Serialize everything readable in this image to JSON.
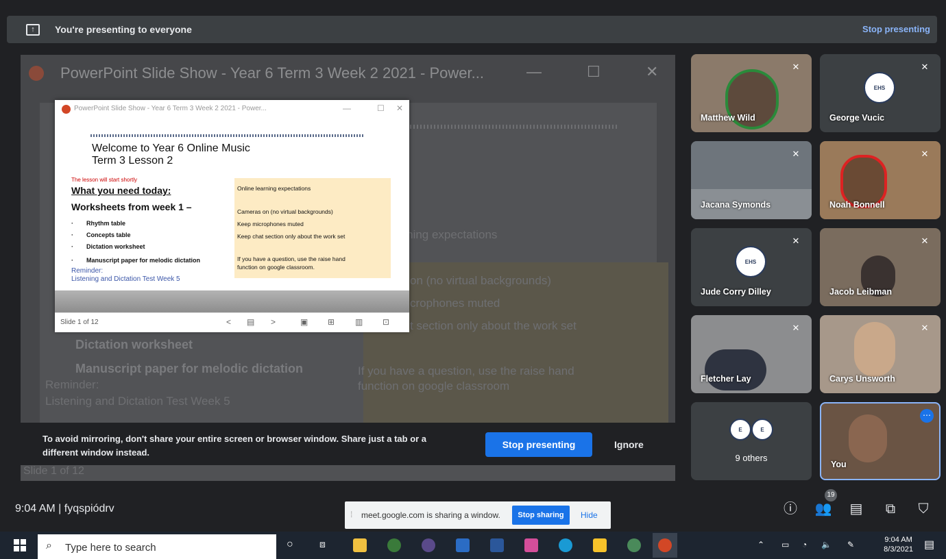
{
  "banner": {
    "text": "You're presenting to everyone",
    "stop_label": "Stop presenting"
  },
  "stage": {
    "bg_title": "PowerPoint Slide Show  -  Year 6 Term 3 Week 2 2021 - Power...",
    "bg_lines": [
      "arning expectations",
      "on (no virtual backgrounds)",
      "crophones muted",
      "t section only about the work set"
    ],
    "bg_items": [
      "Dictation worksheet",
      "Manuscript paper for melodic dictation"
    ],
    "bg_reminder": [
      "Reminder:",
      "Listening and Dictation Test Week 5"
    ],
    "bg_question": [
      "If you have a question, use the raise hand",
      "function on google classroom"
    ],
    "bg_status": "Slide 1 of 12"
  },
  "slide": {
    "window_title": "PowerPoint Slide Show  -  Year 6 Term 3 Week 2 2021 - Power...",
    "title_line1": "Welcome to Year 6 Online Music",
    "title_line2": "Term 3 Lesson 2",
    "red_note": "The lesson will start shortly",
    "need": "What you need today:",
    "worksheets": "Worksheets from week 1 –",
    "items": [
      "Rhythm table",
      "Concepts table",
      "Dictation worksheet",
      "Manuscript paper for melodic dictation"
    ],
    "reminder": "Reminder:",
    "reminder_link": "Listening and Dictation Test Week 5",
    "box_title": "Online learning expectations",
    "box_lines": [
      "Cameras on (no virtual backgrounds)",
      "Keep microphones muted",
      "Keep chat section only about the work set"
    ],
    "box_q1": "If you have a question, use the raise hand",
    "box_q2": "function on google classroom.",
    "status": "Slide 1 of 12"
  },
  "warning": {
    "text": "To avoid mirroring, don't share your entire screen or browser window. Share just a tab or a different window instead.",
    "stop_label": "Stop presenting",
    "ignore_label": "Ignore"
  },
  "participants": [
    {
      "name": "Matthew Wild"
    },
    {
      "name": "George Vucic"
    },
    {
      "name": "Jacana Symonds"
    },
    {
      "name": "Noah Bonnell"
    },
    {
      "name": "Jude Corry Dilley"
    },
    {
      "name": "Jacob Leibman"
    },
    {
      "name": "Fletcher Lay"
    },
    {
      "name": "Carys Unsworth"
    },
    {
      "name": "9 others"
    },
    {
      "name": "You"
    }
  ],
  "meet_bar": {
    "time_code": "9:04 AM  |  fyqspiódrv",
    "people_count": "19"
  },
  "share_bar": {
    "text": "meet.google.com is sharing a window.",
    "stop_label": "Stop sharing",
    "hide_label": "Hide"
  },
  "taskbar": {
    "search_placeholder": "Type here to search",
    "time": "9:04 AM",
    "date": "8/3/2021"
  },
  "colors": {
    "accent": "#1a73e8",
    "link": "#8ab4f8",
    "meet_bg": "#202124"
  }
}
